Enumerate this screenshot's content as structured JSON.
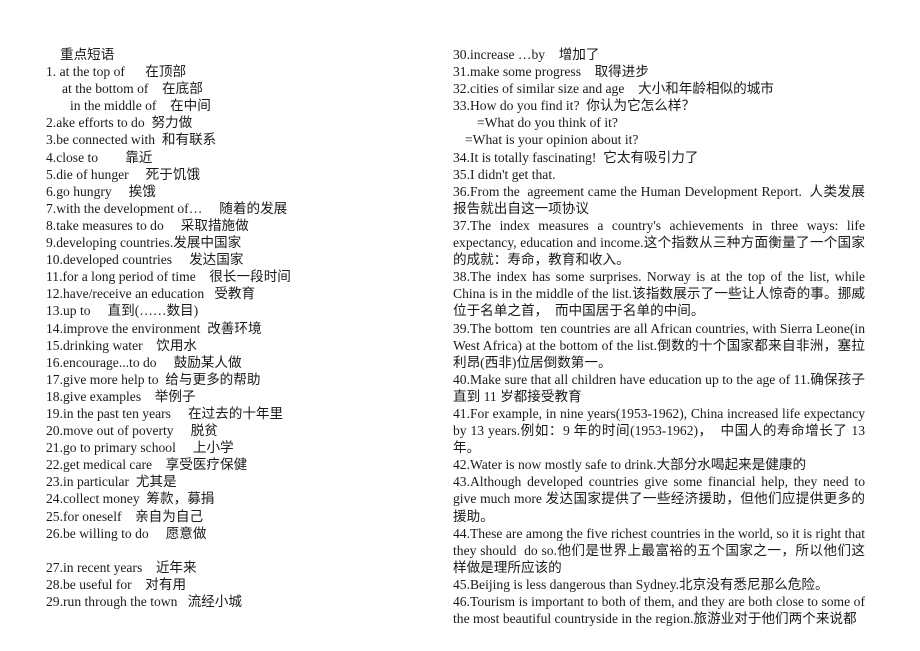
{
  "document": {
    "title": "重点短语",
    "page_background": "#ffffff",
    "text_color": "#1a1a1a"
  },
  "left_column": {
    "heading": "重点短语",
    "lines": [
      {
        "id": "item-1",
        "text": "1. at the top of      在顶部",
        "indent": "none"
      },
      {
        "id": "item-1b",
        "text": "at the bottom of    在底部",
        "indent": "indent1"
      },
      {
        "id": "item-1c",
        "text": "in the middle of    在中间",
        "indent": "indent2"
      },
      {
        "id": "item-2",
        "text": "2.ake efforts to do  努力做",
        "indent": "none"
      },
      {
        "id": "item-3",
        "text": "3.be connected with  和有联系",
        "indent": "none"
      },
      {
        "id": "item-4",
        "text": "4.close to        靠近",
        "indent": "none"
      },
      {
        "id": "item-5",
        "text": "5.die of hunger     死于饥饿",
        "indent": "none"
      },
      {
        "id": "item-6",
        "text": "6.go hungry     挨饿",
        "indent": "none"
      },
      {
        "id": "item-7",
        "text": "7.with the development of…     随着的发展",
        "indent": "none"
      },
      {
        "id": "item-8",
        "text": "8.take measures to do     采取措施做",
        "indent": "none"
      },
      {
        "id": "item-9",
        "text": "9.developing countries.发展中国家",
        "indent": "none"
      },
      {
        "id": "item-10",
        "text": "10.developed countries     发达国家",
        "indent": "none"
      },
      {
        "id": "item-11",
        "text": "11.for a long period of time    很长一段时间",
        "indent": "none"
      },
      {
        "id": "item-12",
        "text": "12.have/receive an education   受教育",
        "indent": "none"
      },
      {
        "id": "item-13",
        "text": "13.up to     直到(……数目)",
        "indent": "none"
      },
      {
        "id": "item-14",
        "text": "14.improve the environment  改善环境",
        "indent": "none"
      },
      {
        "id": "item-15",
        "text": "15.drinking water    饮用水",
        "indent": "none"
      },
      {
        "id": "item-16",
        "text": "16.encourage...to do     鼓励某人做",
        "indent": "none"
      },
      {
        "id": "item-17",
        "text": "17.give more help to  给与更多的帮助",
        "indent": "none"
      },
      {
        "id": "item-18",
        "text": "18.give examples    举例子",
        "indent": "none"
      },
      {
        "id": "item-19",
        "text": "19.in the past ten years     在过去的十年里",
        "indent": "none"
      },
      {
        "id": "item-20",
        "text": "20.move out of poverty     脱贫",
        "indent": "none"
      },
      {
        "id": "item-21",
        "text": "21.go to primary school     上小学",
        "indent": "none"
      },
      {
        "id": "item-22",
        "text": "22.get medical care    享受医疗保健",
        "indent": "none"
      },
      {
        "id": "item-23",
        "text": "23.in particular  尤其是",
        "indent": "none"
      },
      {
        "id": "item-24",
        "text": "24.collect money  筹款，募捐",
        "indent": "none"
      },
      {
        "id": "item-25",
        "text": "25.for oneself    亲自为自己",
        "indent": "none"
      },
      {
        "id": "item-26",
        "text": "26.be willing to do     愿意做",
        "indent": "none"
      },
      {
        "id": "spacer-1",
        "text": "",
        "indent": "blank"
      },
      {
        "id": "item-27",
        "text": "27.in recent years    近年来",
        "indent": "none"
      },
      {
        "id": "item-28",
        "text": "28.be useful for    对有用",
        "indent": "none"
      },
      {
        "id": "item-29",
        "text": "29.run through the town   流经小城",
        "indent": "none"
      }
    ]
  },
  "right_column": {
    "lines": [
      {
        "id": "item-30",
        "text": "30.increase …by    增加了",
        "indent": "none"
      },
      {
        "id": "item-31",
        "text": "31.make some progress    取得进步",
        "indent": "none"
      },
      {
        "id": "item-32",
        "text": "32.cities of similar size and age    大小和年龄相似的城市",
        "indent": "none"
      },
      {
        "id": "item-33",
        "text": "33.How do you find it?  你认为它怎么样？",
        "indent": "none"
      },
      {
        "id": "item-33b",
        "text": "=What do you think of it?",
        "indent": "indent2"
      },
      {
        "id": "item-33c",
        "text": "=What is your opinion about it?",
        "indent": "indent3"
      },
      {
        "id": "item-34",
        "text": "34.It is totally fascinating!  它太有吸引力了",
        "indent": "none"
      },
      {
        "id": "item-35",
        "text": "35.I didn't get that.",
        "indent": "none"
      },
      {
        "id": "item-36",
        "text": "36.From the  agreement came the Human Development Report.  人类发展报告就出自这一项协议",
        "indent": "none"
      },
      {
        "id": "item-37",
        "text": "37.The index measures a country's achievements in three ways: life expectancy, education and income.这个指数从三种方面衡量了一个国家的成就：寿命，教育和收入。",
        "indent": "none"
      },
      {
        "id": "item-38",
        "text": "38.The index has some surprises. Norway is at the top of the list, while China is in the middle of the list.该指数展示了一些让人惊奇的事。挪威位于名单之首，  而中国居于名单的中间。",
        "indent": "none"
      },
      {
        "id": "item-39",
        "text": "39.The bottom  ten countries are all African countries, with Sierra Leone(in West Africa) at the bottom of the list.倒数的十个国家都来自非洲，塞拉利昂(西非)位居倒数第一。",
        "indent": "none"
      },
      {
        "id": "item-40",
        "text": "40.Make sure that all children have education up to the age of 11.确保孩子直到 11 岁都接受教育",
        "indent": "none"
      },
      {
        "id": "item-41",
        "text": "41.For example, in nine years(1953-1962), China increased life expectancy by 13 years.例如：9 年的时间(1953-1962)，  中国人的寿命增长了 13 年。",
        "indent": "none"
      },
      {
        "id": "item-42",
        "text": "42.Water is now mostly safe to drink.大部分水喝起来是健康的",
        "indent": "none"
      },
      {
        "id": "item-43",
        "text": "43.Although developed countries give some financial help, they need to give much more 发达国家提供了一些经济援助，但他们应提供更多的援助。",
        "indent": "none"
      },
      {
        "id": "item-44",
        "text": "44.These are among the five richest countries in the world, so it is right that they should  do so.他们是世界上最富裕的五个国家之一，所以他们这样做是理所应该的",
        "indent": "none"
      },
      {
        "id": "item-45",
        "text": "45.Beijing is less dangerous than Sydney.北京没有悉尼那么危险。",
        "indent": "none"
      },
      {
        "id": "item-46",
        "text": "46.Tourism is important to both of them, and they are both close to some of the most beautiful countryside in the region.旅游业对于他们两个来说都",
        "indent": "none"
      }
    ]
  }
}
